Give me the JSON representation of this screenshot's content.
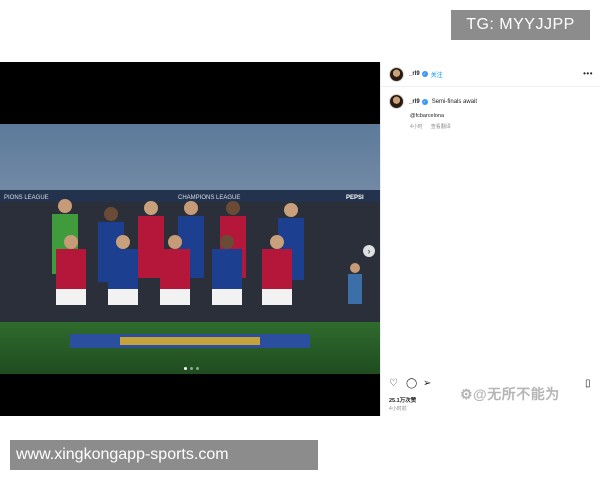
{
  "tg_badge": "TG: MYYJJPP",
  "url_bar": "www.xingkongapp-sports.com",
  "post": {
    "header": {
      "username": "_rl9",
      "follow_label": "关注",
      "more_icon": "more-horizontal-icon"
    },
    "caption": {
      "username": "_rl9",
      "text": "Semi-finals await",
      "mention": "@fcbarcelona",
      "time_ago": "4小时",
      "translate": "查看翻译"
    },
    "likes": "25.1万次赞",
    "timestamp": "4小时前",
    "watermark": "无所不能为",
    "photo": {
      "description_icon": "team-photo",
      "stadium_banner_left": "PIONS LEAGUE",
      "stadium_banner_mid": "CHAMPIONS LEAGUE",
      "stadium_banner_right": "PEPSI",
      "carousel_pages": 3,
      "carousel_active": 1
    },
    "colors": {
      "verified": "#3897f0",
      "follow": "#0095f6",
      "barca_blue": "#1d3f8f",
      "barca_red": "#b5173b",
      "keeper_green": "#3f9b3c"
    }
  }
}
